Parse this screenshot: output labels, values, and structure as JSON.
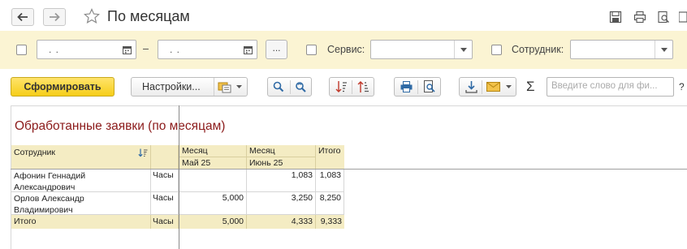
{
  "window": {
    "title": "По месяцам"
  },
  "filters": {
    "date_from_value": ".  .",
    "date_to_value": ".  .",
    "dash": "–",
    "dots_label": "...",
    "service_label": "Сервис:",
    "service_value": "",
    "employee_label": "Сотрудник:",
    "employee_value": ""
  },
  "toolbar": {
    "generate_label": "Сформировать",
    "settings_label": "Настройки...",
    "search_placeholder": "Введите слово для фи...",
    "sigma": "Σ",
    "help": "?"
  },
  "report": {
    "title": "Обработанные заявки (по месяцам)",
    "columns": {
      "employee": "Сотрудник",
      "month_header_1": "Месяц",
      "month_header_2": "Месяц",
      "total_header": "Итого",
      "month_1": "Май 25",
      "month_2": "Июнь 25"
    },
    "rows": [
      {
        "employee_line1": "Афонин Геннадий",
        "employee_line2": "Александрович",
        "unit": "Часы",
        "m1": "",
        "m2": "1,083",
        "total": "1,083"
      },
      {
        "employee_line1": "Орлов Александр",
        "employee_line2": "Владимирович",
        "unit": "Часы",
        "m1": "5,000",
        "m2": "3,250",
        "total": "8,250"
      }
    ],
    "grand_total": {
      "label": "Итого",
      "unit": "Часы",
      "m1": "5,000",
      "m2": "4,333",
      "total": "9,333"
    }
  },
  "colors": {
    "filter_bg": "#fbf4d3",
    "generate_button": "#f6ce19",
    "report_title": "#8b1a1a",
    "header_bg": "#f4ecc3"
  }
}
